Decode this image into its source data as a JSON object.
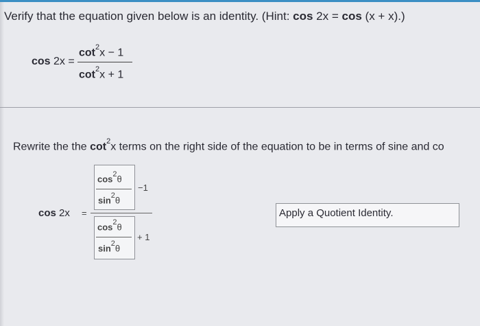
{
  "prompt": {
    "lead": "Verify that the equation given below is an identity. (Hint: ",
    "hint_a": "cos",
    "hint_a_arg": " 2x = ",
    "hint_b": "cos",
    "hint_b_arg": " (x + x).)"
  },
  "equation": {
    "lhs_fn": "cos",
    "lhs_arg": " 2x =",
    "num_fn": "cot",
    "num_exp": "2",
    "num_rest": "x − 1",
    "den_fn": "cot",
    "den_exp": "2",
    "den_rest": "x + 1"
  },
  "step": {
    "instruction_pre": "Rewrite the the ",
    "instruction_fn": "cot",
    "instruction_exp": "2",
    "instruction_post": "x terms on the right side of the equation to be in terms of sine and co",
    "lhs_fn": "cos",
    "lhs_arg": " 2x",
    "equals": "=",
    "top_num_fn": "cos",
    "top_num_exp": "2",
    "top_num_var": "θ",
    "top_den_fn": "sin",
    "top_den_exp": "2",
    "top_den_var": "θ",
    "top_op": "−1",
    "bot_num_fn": "cos",
    "bot_num_exp": "2",
    "bot_num_var": "θ",
    "bot_den_fn": "sin",
    "bot_den_exp": "2",
    "bot_den_var": "θ",
    "bot_op": "+ 1",
    "reason_value": "Apply a Quotient Identity."
  }
}
